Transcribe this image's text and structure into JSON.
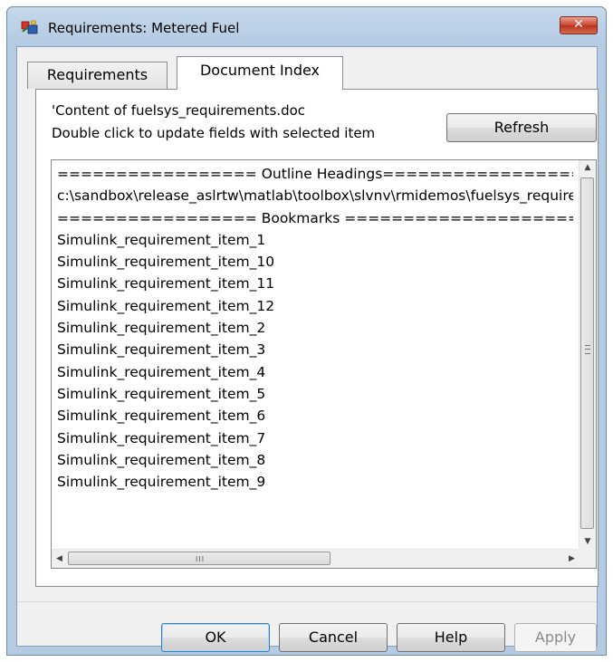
{
  "window": {
    "title": "Requirements: Metered Fuel",
    "close_glyph": "✕"
  },
  "tabs": [
    {
      "label": "Requirements",
      "selected": false
    },
    {
      "label": "Document Index",
      "selected": true
    }
  ],
  "panel": {
    "info_line1": "'Content of fuelsys_requirements.doc",
    "info_line2": "Double click to update fields with selected item",
    "refresh_label": "Refresh"
  },
  "list": {
    "items": [
      "================= Outline Headings===========================",
      "c:\\sandbox\\release_aslrtw\\matlab\\toolbox\\slvnv\\rmidemos\\fuelsys_requirements.doc",
      "================= Bookmarks ===========================",
      "Simulink_requirement_item_1",
      "Simulink_requirement_item_10",
      "Simulink_requirement_item_11",
      "Simulink_requirement_item_12",
      "Simulink_requirement_item_2",
      "Simulink_requirement_item_3",
      "Simulink_requirement_item_4",
      "Simulink_requirement_item_5",
      "Simulink_requirement_item_6",
      "Simulink_requirement_item_7",
      "Simulink_requirement_item_8",
      "Simulink_requirement_item_9"
    ],
    "icons": {
      "up": "▲",
      "down": "▼",
      "left": "◀",
      "right": "▶",
      "grip": "III"
    }
  },
  "buttons": {
    "ok": "OK",
    "cancel": "Cancel",
    "help": "Help",
    "apply": "Apply"
  }
}
